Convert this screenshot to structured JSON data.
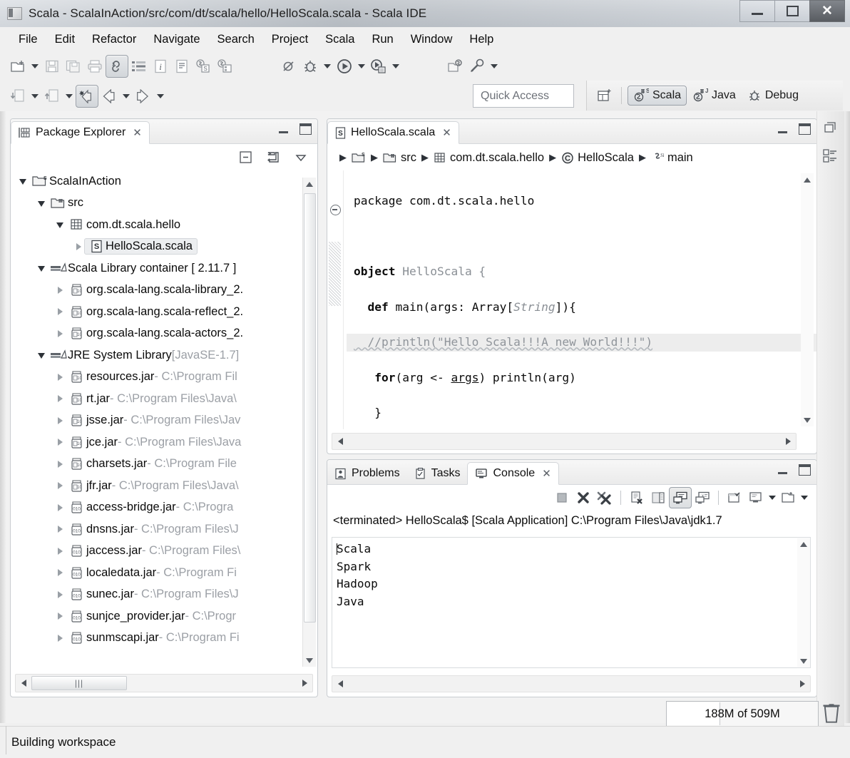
{
  "window": {
    "title": "Scala - ScalaInAction/src/com/dt/scala/hello/HelloScala.scala - Scala IDE",
    "minimize_label": "Minimize",
    "maximize_label": "Maximize",
    "close_label": "✕"
  },
  "menubar": {
    "items": [
      "File",
      "Edit",
      "Refactor",
      "Navigate",
      "Search",
      "Project",
      "Scala",
      "Run",
      "Window",
      "Help"
    ]
  },
  "toolbar": {
    "row1": [
      {
        "name": "new-wizard",
        "icon": "new-file-icon",
        "dropdown": true,
        "pressed": false
      },
      {
        "name": "save",
        "icon": "save-icon",
        "dropdown": false,
        "pressed": false
      },
      {
        "name": "save-all",
        "icon": "save-all-icon",
        "dropdown": false,
        "pressed": false
      },
      {
        "name": "print",
        "icon": "print-icon",
        "dropdown": false,
        "pressed": false
      },
      {
        "name": "toggle-mark-occurrences",
        "icon": "mark-occurrences-icon",
        "dropdown": false,
        "pressed": true
      },
      {
        "name": "open-task",
        "icon": "task-list-icon",
        "dropdown": false,
        "pressed": false
      },
      {
        "name": "quick-info",
        "icon": "info-icon",
        "dropdown": false,
        "pressed": false
      },
      {
        "name": "open-declaration",
        "icon": "document-icon",
        "dropdown": false,
        "pressed": false
      },
      {
        "name": "new-scala-class",
        "icon": "new-scala-class-icon",
        "dropdown": false,
        "pressed": false
      },
      {
        "name": "new-scala-object",
        "icon": "new-scala-object-icon",
        "dropdown": false,
        "pressed": false
      }
    ],
    "row1b": [
      {
        "name": "skip-breakpoints",
        "icon": "skip-breakpoints-icon",
        "dropdown": false,
        "pressed": false
      },
      {
        "name": "debug",
        "icon": "debug-bug-icon",
        "dropdown": true,
        "pressed": false
      },
      {
        "name": "run",
        "icon": "run-play-icon",
        "dropdown": true,
        "pressed": false
      },
      {
        "name": "external-tools",
        "icon": "external-tools-icon",
        "dropdown": true,
        "pressed": false
      },
      {
        "name": "open-type",
        "icon": "open-type-icon",
        "dropdown": false,
        "pressed": false
      },
      {
        "name": "search",
        "icon": "search-pencil-icon",
        "dropdown": true,
        "pressed": false
      }
    ],
    "row2": [
      {
        "name": "previous-annotation",
        "icon": "prev-annotation-icon",
        "dropdown": true,
        "pressed": false
      },
      {
        "name": "next-annotation",
        "icon": "next-annotation-icon",
        "dropdown": true,
        "pressed": false
      },
      {
        "name": "last-edit-location",
        "icon": "last-edit-icon",
        "dropdown": false,
        "pressed": true
      },
      {
        "name": "back",
        "icon": "back-arrow-icon",
        "dropdown": true,
        "pressed": false
      },
      {
        "name": "forward",
        "icon": "forward-arrow-icon",
        "dropdown": true,
        "pressed": false
      }
    ]
  },
  "quick_access": {
    "placeholder": "Quick Access",
    "value": ""
  },
  "perspectives": {
    "open_perspective_label": "Open Perspective",
    "items": [
      {
        "label": "Scala",
        "icon": "scala-perspective-icon",
        "active": true
      },
      {
        "label": "Java",
        "icon": "java-perspective-icon",
        "active": false
      },
      {
        "label": "Debug",
        "icon": "debug-perspective-icon",
        "active": false
      }
    ]
  },
  "package_explorer": {
    "tab_label": "Package Explorer",
    "tab_close": "✕",
    "toolbar": [
      {
        "name": "collapse-all",
        "icon": "collapse-all-icon"
      },
      {
        "name": "link-with-editor",
        "icon": "link-editor-icon"
      },
      {
        "name": "view-menu",
        "icon": "chevron-down-icon"
      }
    ],
    "tree": [
      {
        "indent": 0,
        "twisty": "open",
        "icon": "scala-project-icon",
        "label": "ScalaInAction",
        "sub": "",
        "selected": false
      },
      {
        "indent": 1,
        "twisty": "open",
        "icon": "source-folder-icon",
        "label": "src",
        "sub": "",
        "selected": false
      },
      {
        "indent": 2,
        "twisty": "open",
        "icon": "package-icon",
        "label": "com.dt.scala.hello",
        "sub": "",
        "selected": false
      },
      {
        "indent": 3,
        "twisty": "closed",
        "icon": "scala-file-icon",
        "label": "HelloScala.scala",
        "sub": "",
        "selected": true
      },
      {
        "indent": 1,
        "twisty": "open",
        "icon": "library-icon",
        "label": "Scala Library container [ 2.11.7 ]",
        "sub": "",
        "selected": false
      },
      {
        "indent": 2,
        "twisty": "closed",
        "icon": "jar-icon",
        "label": "org.scala-lang.scala-library_2.",
        "sub": "",
        "selected": false
      },
      {
        "indent": 2,
        "twisty": "closed",
        "icon": "jar-icon",
        "label": "org.scala-lang.scala-reflect_2.",
        "sub": "",
        "selected": false
      },
      {
        "indent": 2,
        "twisty": "closed",
        "icon": "jar-icon",
        "label": "org.scala-lang.scala-actors_2.",
        "sub": "",
        "selected": false
      },
      {
        "indent": 1,
        "twisty": "open",
        "icon": "library-icon",
        "label": "JRE System Library ",
        "sub": "[JavaSE-1.7]",
        "selected": false
      },
      {
        "indent": 2,
        "twisty": "closed",
        "icon": "jar-icon",
        "label": "resources.jar",
        "sub": " - C:\\Program Fil",
        "selected": false
      },
      {
        "indent": 2,
        "twisty": "closed",
        "icon": "jar-icon",
        "label": "rt.jar",
        "sub": " - C:\\Program Files\\Java\\",
        "selected": false
      },
      {
        "indent": 2,
        "twisty": "closed",
        "icon": "jar-icon",
        "label": "jsse.jar",
        "sub": " - C:\\Program Files\\Jav",
        "selected": false
      },
      {
        "indent": 2,
        "twisty": "closed",
        "icon": "jar-icon",
        "label": "jce.jar",
        "sub": " - C:\\Program Files\\Java",
        "selected": false
      },
      {
        "indent": 2,
        "twisty": "closed",
        "icon": "jar-icon",
        "label": "charsets.jar",
        "sub": " - C:\\Program File",
        "selected": false
      },
      {
        "indent": 2,
        "twisty": "closed",
        "icon": "jar-icon",
        "label": "jfr.jar",
        "sub": " - C:\\Program Files\\Java\\",
        "selected": false
      },
      {
        "indent": 2,
        "twisty": "closed",
        "icon": "jar-plain-icon",
        "label": "access-bridge.jar",
        "sub": " - C:\\Progra",
        "selected": false
      },
      {
        "indent": 2,
        "twisty": "closed",
        "icon": "jar-plain-icon",
        "label": "dnsns.jar",
        "sub": " - C:\\Program Files\\J",
        "selected": false
      },
      {
        "indent": 2,
        "twisty": "closed",
        "icon": "jar-plain-icon",
        "label": "jaccess.jar",
        "sub": " - C:\\Program Files\\",
        "selected": false
      },
      {
        "indent": 2,
        "twisty": "closed",
        "icon": "jar-plain-icon",
        "label": "localedata.jar",
        "sub": " - C:\\Program Fi",
        "selected": false
      },
      {
        "indent": 2,
        "twisty": "closed",
        "icon": "jar-plain-icon",
        "label": "sunec.jar",
        "sub": " - C:\\Program Files\\J",
        "selected": false
      },
      {
        "indent": 2,
        "twisty": "closed",
        "icon": "jar-plain-icon",
        "label": "sunjce_provider.jar",
        "sub": " - C:\\Progr",
        "selected": false
      },
      {
        "indent": 2,
        "twisty": "closed",
        "icon": "jar-plain-icon",
        "label": "sunmscapi.jar",
        "sub": " - C:\\Program Fi",
        "selected": false
      }
    ],
    "hscroll_grip": "|||"
  },
  "editor": {
    "tab_label": "HelloScala.scala",
    "tab_close": "✕",
    "tab_icon": "scala-file-icon",
    "breadcrumb": [
      {
        "icon": "scala-project-icon",
        "label": ""
      },
      {
        "icon": "source-folder-icon",
        "label": "src"
      },
      {
        "icon": "package-icon",
        "label": "com.dt.scala.hello"
      },
      {
        "icon": "scala-object-icon",
        "label": "HelloScala"
      },
      {
        "icon": "scala-method-icon",
        "label": "main"
      }
    ],
    "breadcrumb_separator": "▶",
    "code": {
      "line1": "package com.dt.scala.hello",
      "line2": "",
      "line3_kw": "object",
      "line3_name": " HelloScala {",
      "line4_kw": "  def",
      "line4_a": " main(args: ",
      "line4_type": "Array[",
      "line4_gen": "String",
      "line4_b": "]){",
      "line5_comment": "  //println(\"Hello Scala!!!A new World!!!\")",
      "line6_kw": "   for",
      "line6_a": "(arg <- ",
      "line6_args": "args",
      "line6_b": ") println(arg)",
      "line7": "   }",
      "line8": " }"
    }
  },
  "console": {
    "tabs": [
      {
        "label": "Problems",
        "icon": "problems-icon",
        "active": false,
        "close": ""
      },
      {
        "label": "Tasks",
        "icon": "tasks-icon",
        "active": false,
        "close": ""
      },
      {
        "label": "Console",
        "icon": "console-icon",
        "active": true,
        "close": "✕"
      }
    ],
    "toolbar": [
      {
        "name": "terminate",
        "icon": "terminate-square-icon",
        "pressed": false,
        "dropdown": false
      },
      {
        "name": "remove-launch",
        "icon": "remove-x-icon",
        "pressed": false,
        "dropdown": false
      },
      {
        "name": "remove-all-terminated",
        "icon": "remove-all-xx-icon",
        "pressed": false,
        "dropdown": false
      },
      {
        "name": "clear-console",
        "icon": "clear-console-icon",
        "pressed": false,
        "dropdown": false
      },
      {
        "name": "scroll-lock",
        "icon": "scroll-lock-icon",
        "pressed": false,
        "dropdown": false
      },
      {
        "name": "show-console-on-output",
        "icon": "show-on-output-icon",
        "pressed": true,
        "dropdown": false
      },
      {
        "name": "show-console-on-error",
        "icon": "show-on-error-icon",
        "pressed": false,
        "dropdown": false
      },
      {
        "name": "pin-console",
        "icon": "pin-console-icon",
        "pressed": false,
        "dropdown": false
      },
      {
        "name": "display-selected-console",
        "icon": "display-console-icon",
        "pressed": false,
        "dropdown": true
      },
      {
        "name": "open-console",
        "icon": "open-console-icon",
        "pressed": false,
        "dropdown": true
      }
    ],
    "launch_header": "<terminated> HelloScala$ [Scala Application] C:\\Program Files\\Java\\jdk1.7",
    "output": [
      "Scala",
      "Spark",
      "Hadoop",
      "Java"
    ]
  },
  "fastview": {
    "items": [
      {
        "name": "restore-view",
        "icon": "restore-icon"
      },
      {
        "name": "outline-view",
        "icon": "outline-icon"
      }
    ]
  },
  "status": {
    "message": "Building workspace",
    "heap": "188M of 509M",
    "trash_name": "run-garbage-collector"
  }
}
